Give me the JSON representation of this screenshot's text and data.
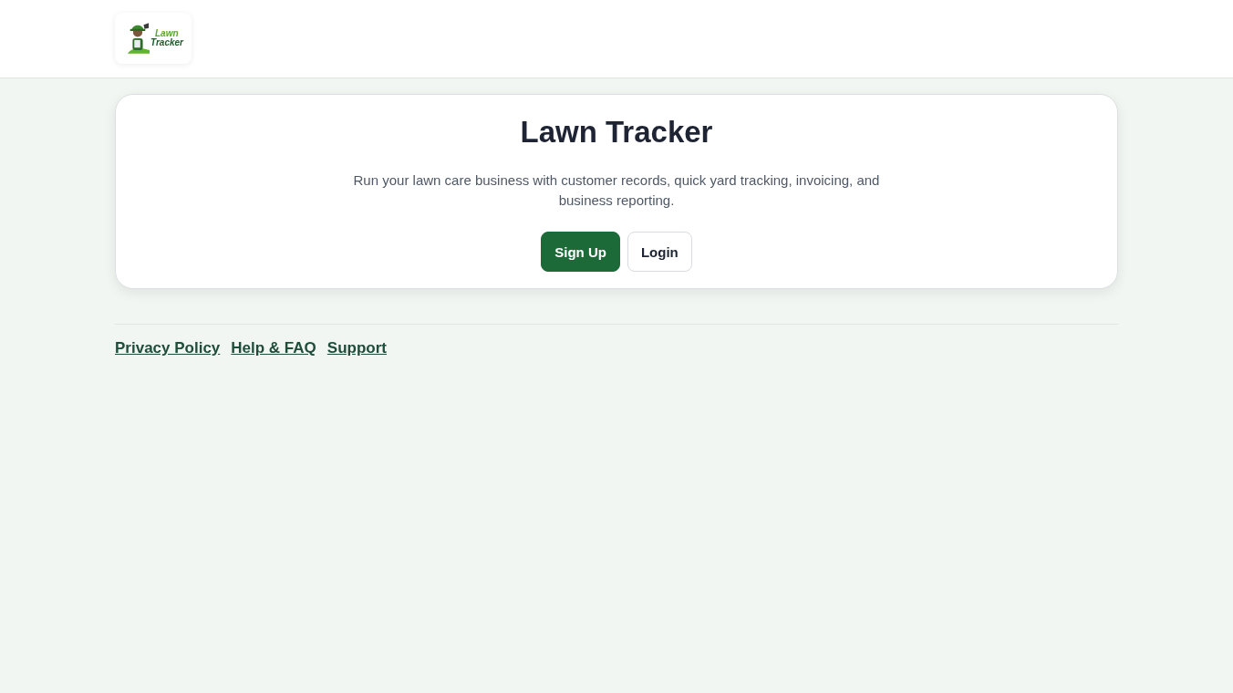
{
  "header": {
    "logo": {
      "lines": [
        "Lawn",
        "Tracker"
      ]
    }
  },
  "hero": {
    "title": "Lawn Tracker",
    "description": "Run your lawn care business with customer records, quick yard tracking, invoicing, and business reporting.",
    "buttons": [
      {
        "label": "Sign Up",
        "kind": "primary"
      },
      {
        "label": "Login",
        "kind": "secondary"
      }
    ]
  },
  "footer": {
    "links": [
      "Privacy Policy",
      "Help & FAQ",
      "Support"
    ]
  }
}
